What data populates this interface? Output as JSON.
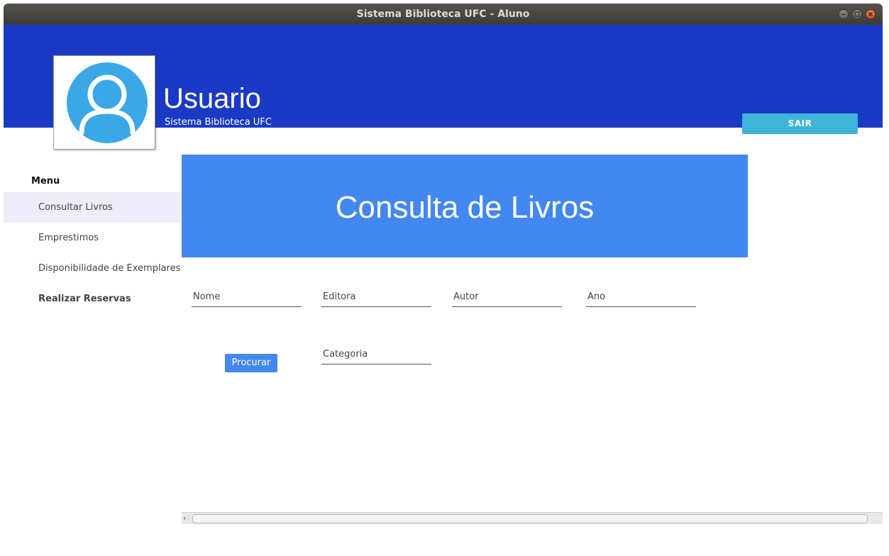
{
  "window": {
    "title": "Sistema Biblioteca UFC - Aluno"
  },
  "header": {
    "user_name": "Usuario",
    "subtitle": "Sistema Biblioteca UFC",
    "logout_label": "SAIR",
    "background": "#1a3ac6",
    "logout_color": "#3fb5d8"
  },
  "avatar": {
    "icon": "user-avatar-icon",
    "color": "#3aa8e6"
  },
  "menu": {
    "title": "Menu",
    "items": [
      {
        "label": "Consultar Livros",
        "active": true
      },
      {
        "label": "Emprestimos",
        "active": false
      },
      {
        "label": "Disponibilidade de Exemplares",
        "active": false
      },
      {
        "label": "Realizar Reservas",
        "active": false
      }
    ]
  },
  "banner": {
    "title": "Consulta de Livros",
    "background": "#4387f0"
  },
  "search": {
    "fields": {
      "nome": {
        "value": "",
        "placeholder": "Nome"
      },
      "editora": {
        "value": "",
        "placeholder": "Editora"
      },
      "autor": {
        "value": "",
        "placeholder": "Autor"
      },
      "ano": {
        "value": "",
        "placeholder": "Ano"
      },
      "categoria": {
        "value": "",
        "placeholder": "Categoria"
      }
    },
    "button_label": "Procurar"
  }
}
